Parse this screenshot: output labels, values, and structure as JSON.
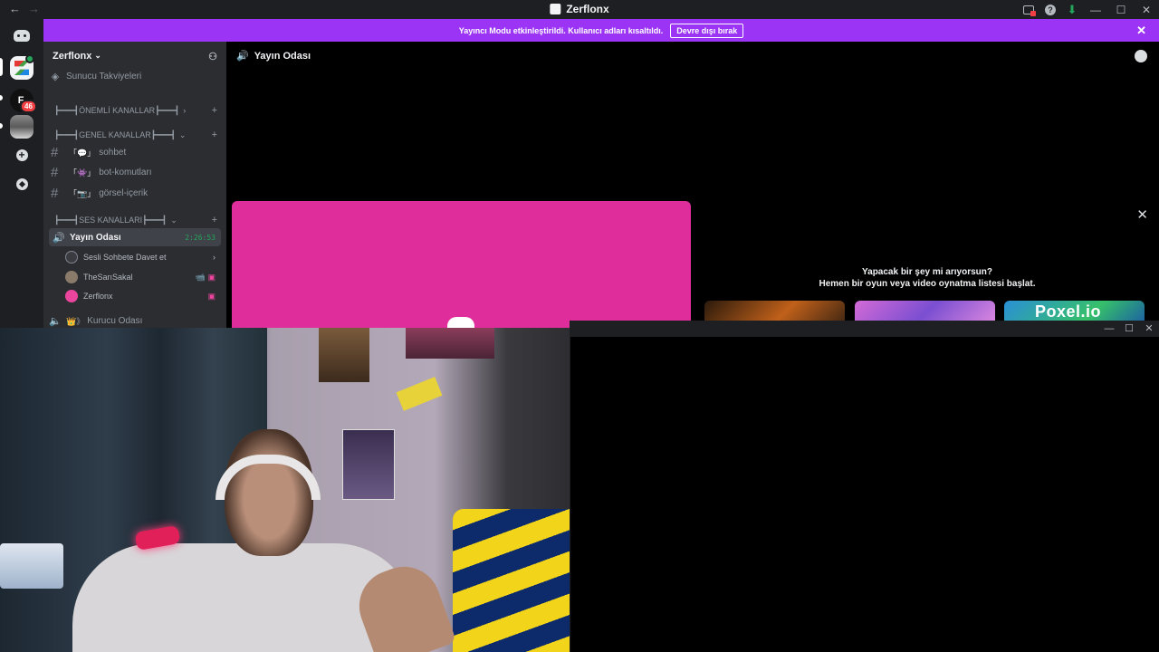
{
  "titlebar": {
    "app_title": "Zerflonx",
    "back_glyph": "←",
    "forward_glyph": "→",
    "icons": [
      "screen-share-icon",
      "help-icon",
      "download-icon"
    ],
    "help_glyph": "?",
    "download_glyph": "⬇",
    "minimize_glyph": "—",
    "maximize_glyph": "☐",
    "close_glyph": "✕"
  },
  "banner": {
    "message": "Yayıncı Modu etkinleştirildi. Kullanıcı adları kısaltıldı.",
    "button": "Devre dışı bırak",
    "close_glyph": "✕",
    "color": "#9b34f5"
  },
  "guilds": {
    "f_label": "F.",
    "badge": "46",
    "add_glyph": "+"
  },
  "sidebar": {
    "server_name": "Zerflonx",
    "chevron": "⌄",
    "invite_glyph": "⚇",
    "boost_label": "Sunucu Takviyeleri",
    "categories": [
      {
        "label": "┣━━━┫ÖNEMLİ KANALLAR┣━━━┫",
        "chev": "›",
        "plus": "+"
      },
      {
        "label": "┣━━━┫GENEL KANALLAR┣━━━┫",
        "chev": "⌄",
        "plus": "+"
      },
      {
        "label": "┣━━━┫SES KANALLARI┣━━━┫",
        "chev": "⌄",
        "plus": "+"
      }
    ],
    "channels": [
      {
        "hash": "#",
        "emoji": "「💬」",
        "name": "sohbet"
      },
      {
        "hash": "#",
        "emoji": "「👾」",
        "name": "bot-komutları"
      },
      {
        "hash": "#",
        "emoji": "「📷」",
        "name": "görsel-içerik"
      }
    ],
    "active_voice": {
      "name": "Yayın Odası",
      "timer": "2:26:53"
    },
    "voice_users": [
      {
        "name": "Sesli Sohbete Davet et",
        "right": "›"
      },
      {
        "name": "TheSarıSakal",
        "right": "📹 ▣"
      },
      {
        "name": "Zerflonx",
        "right": "▣"
      }
    ],
    "next_voice": {
      "emoji": "👑》",
      "name": "Kurucu Odası"
    }
  },
  "main": {
    "channel_title": "Yayın Odası",
    "activity": {
      "close_glyph": "✕",
      "line1": "Yapacak bir şey mi arıyorsun?",
      "line2": "Hemen bir oyun veya video oynatma listesi başlat.",
      "games": [
        "",
        "",
        "Poxel.io"
      ]
    }
  },
  "popout": {
    "minimize_glyph": "—",
    "maximize_glyph": "☐",
    "close_glyph": "✕"
  },
  "colors": {
    "accent_pink": "#df2d9b",
    "online_green": "#23a55a",
    "sidebar_bg": "#2b2d31"
  }
}
